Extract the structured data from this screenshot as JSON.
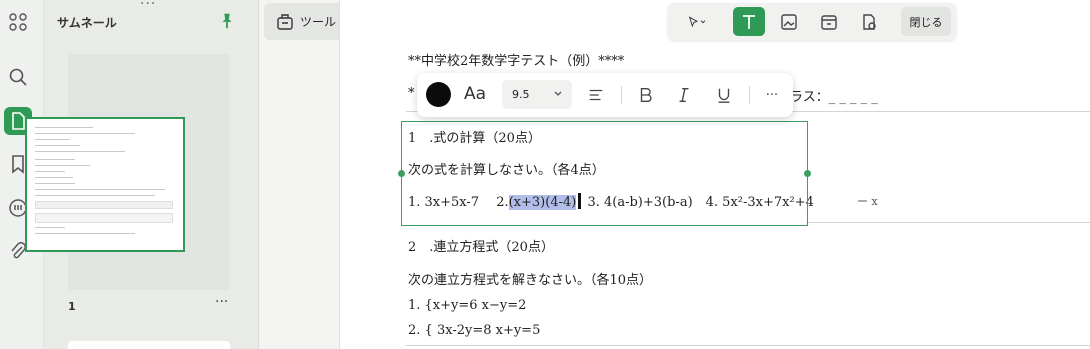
{
  "sidebar": {
    "panel_title": "サムネール",
    "page_number": "1",
    "more": "···"
  },
  "toolbar": {
    "tools_label": "ツール",
    "close_label": "閉じる"
  },
  "format_bar": {
    "font_size": "9.5",
    "font_label": "Aa",
    "more": "···",
    "text_color": "#0b0b0b"
  },
  "document": {
    "title": "**中学校2年数学字テスト（例）****",
    "class_line_prefix": "*",
    "class_line": "ラス：_ _ _ _ _",
    "section1_title": "1　.式の計算（20点）",
    "section1_instr": "次の式を計算しなさい。（各4点）",
    "problems_a": "1. 3x+5x-7　 2.",
    "problems_selected": "(x+3)(4-4)",
    "problems_b": " 3. 4(a-b)+3(b-a)　4. 5x²-3x+7x²+4",
    "stray_mark": "ー x",
    "section2_title": "2　.連立方程式（20点）",
    "section2_instr": "次の連立方程式を解きなさい。（各10点）",
    "eq1": "1. {x+y=6 x−y=2",
    "eq2": "2. { 3x-2y=8 x+y=5"
  },
  "colors": {
    "accent": "#2f9a55",
    "selection_highlight": "#b3bde9"
  }
}
